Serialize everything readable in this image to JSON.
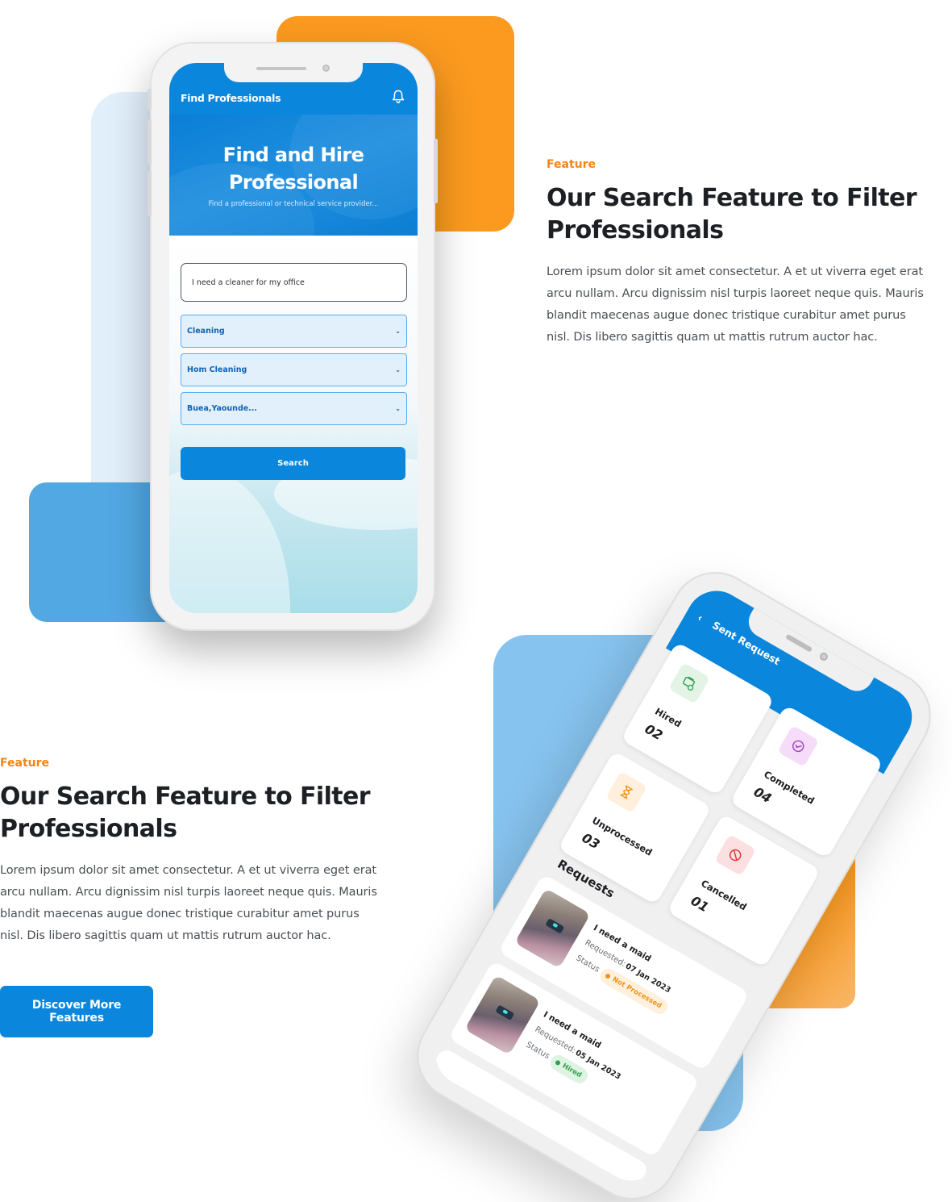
{
  "colors": {
    "accent_blue": "#0b86dd",
    "accent_orange": "#fb9a1f",
    "eyebrow_orange": "#f2841a",
    "panel_light_blue": "#e1effb",
    "panel_mid_blue": "#86c3ee",
    "status_not_processed": "#f29417",
    "status_hired": "#2ea14a"
  },
  "feature_1": {
    "eyebrow": "Feature",
    "heading": "Our Search Feature to Filter Professionals",
    "body": "Lorem ipsum dolor sit amet consectetur. A et ut viverra eget erat arcu nullam. Arcu dignissim nisl turpis laoreet neque quis. Mauris blandit maecenas augue donec tristique curabitur amet purus nisl. Dis libero sagittis quam ut mattis rutrum auctor hac."
  },
  "feature_2": {
    "eyebrow": "Feature",
    "heading": "Our Search Feature to Filter Professionals",
    "body": "Lorem ipsum dolor sit amet consectetur. A et ut viverra eget erat arcu nullam. Arcu dignissim nisl turpis laoreet neque quis. Mauris blandit maecenas augue donec tristique curabitur amet purus nisl. Dis libero sagittis quam ut mattis rutrum auctor hac.",
    "cta_label": "Discover More Features"
  },
  "search_screen": {
    "app_title": "Find Professionals",
    "bell_icon": "bell-icon",
    "hero_title_line1": "Find and Hire",
    "hero_title_line2": "Professional",
    "hero_subtitle": "Find a professional or technical service provider...",
    "query_value": "I need a cleaner for my office",
    "category_selected": "Cleaning",
    "subcategory_selected": "Hom Cleaning",
    "location_selected": "Buea,Yaounde...",
    "dropdown_icon": "chevron-down-icon",
    "search_label": "Search"
  },
  "requests_screen": {
    "app_title": "Sent Request",
    "back_icon": "back-arrow-icon",
    "stats": [
      {
        "label": "Hired",
        "value": "02",
        "icon": "hired-icon",
        "icon_bg": "#e3f4e6",
        "icon_color": "#2ea14a"
      },
      {
        "label": "Completed",
        "value": "04",
        "icon": "check-circle-icon",
        "icon_bg": "#f5dcf8",
        "icon_color": "#a23fbd"
      },
      {
        "label": "Unprocessed",
        "value": "03",
        "icon": "hourglass-icon",
        "icon_bg": "#fff0dd",
        "icon_color": "#f29417"
      },
      {
        "label": "Cancelled",
        "value": "01",
        "icon": "cancel-icon",
        "icon_bg": "#fcdfe0",
        "icon_color": "#e23b3f"
      }
    ],
    "requests_heading": "Requests",
    "requests": [
      {
        "title": "I need a maid",
        "requested_label": "Requested:",
        "requested_date": "07 Jan 2023",
        "status_label": "Status",
        "status": "Not Processed",
        "status_tone": "orange"
      },
      {
        "title": "I need a maid",
        "requested_label": "Requested:",
        "requested_date": "05 Jan 2023",
        "status_label": "Status",
        "status": "Hired",
        "status_tone": "green"
      }
    ]
  }
}
